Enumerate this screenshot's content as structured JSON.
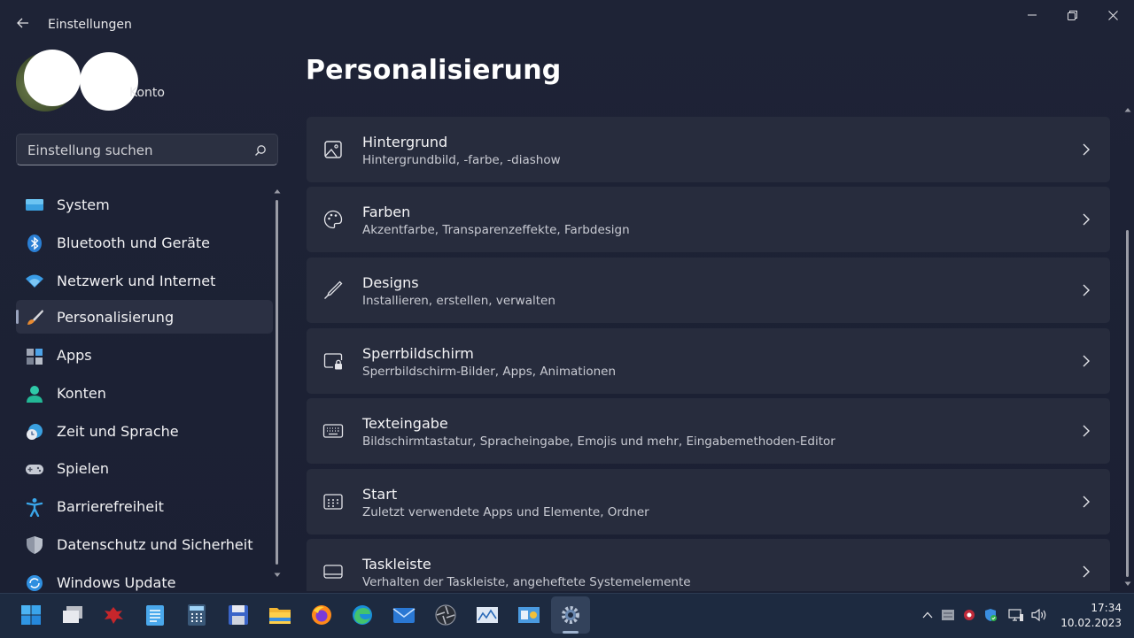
{
  "window": {
    "app_title": "Einstellungen",
    "controls": [
      "minimize",
      "restore",
      "close"
    ]
  },
  "account": {
    "label": "Konto"
  },
  "search": {
    "placeholder": "Einstellung suchen"
  },
  "nav": {
    "items": [
      {
        "label": "System",
        "icon": "monitor-icon"
      },
      {
        "label": "Bluetooth und Geräte",
        "icon": "bluetooth-icon"
      },
      {
        "label": "Netzwerk und Internet",
        "icon": "wifi-icon"
      },
      {
        "label": "Personalisierung",
        "icon": "brush-icon",
        "active": true
      },
      {
        "label": "Apps",
        "icon": "apps-icon"
      },
      {
        "label": "Konten",
        "icon": "person-icon"
      },
      {
        "label": "Zeit und Sprache",
        "icon": "clock-globe-icon"
      },
      {
        "label": "Spielen",
        "icon": "gamepad-icon"
      },
      {
        "label": "Barrierefreiheit",
        "icon": "accessibility-icon"
      },
      {
        "label": "Datenschutz und Sicherheit",
        "icon": "shield-icon"
      },
      {
        "label": "Windows Update",
        "icon": "update-icon"
      }
    ]
  },
  "main": {
    "title": "Personalisierung",
    "cards": [
      {
        "title": "Hintergrund",
        "subtitle": "Hintergrundbild, -farbe, -diashow",
        "icon": "image-icon"
      },
      {
        "title": "Farben",
        "subtitle": "Akzentfarbe, Transparenzeffekte, Farbdesign",
        "icon": "palette-icon"
      },
      {
        "title": "Designs",
        "subtitle": "Installieren, erstellen, verwalten",
        "icon": "pen-icon"
      },
      {
        "title": "Sperrbildschirm",
        "subtitle": "Sperrbildschirm-Bilder, Apps, Animationen",
        "icon": "lock-screen-icon"
      },
      {
        "title": "Texteingabe",
        "subtitle": "Bildschirmtastatur, Spracheingabe, Emojis und mehr, Eingabemethoden-Editor",
        "icon": "keyboard-icon"
      },
      {
        "title": "Start",
        "subtitle": "Zuletzt verwendete Apps und Elemente, Ordner",
        "icon": "start-icon"
      },
      {
        "title": "Taskleiste",
        "subtitle": "Verhalten der Taskleiste, angeheftete Systemelemente",
        "icon": "taskbar-icon"
      }
    ]
  },
  "taskbar": {
    "clock": {
      "time": "17:34",
      "date": "10.02.2023"
    }
  },
  "colors": {
    "background": "#1c2236",
    "card": "#272c3d",
    "nav_active": "#2b3043",
    "taskbar": "#1d2a40"
  }
}
